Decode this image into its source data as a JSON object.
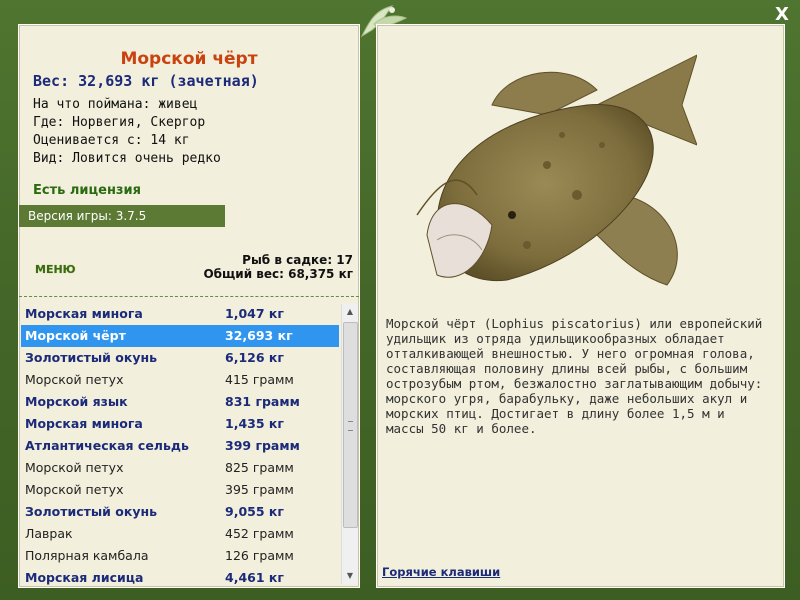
{
  "window": {
    "close_label": "X"
  },
  "fish": {
    "name": "Морской чёрт",
    "weight": "Вес: 32,693 кг (зачетная)",
    "info": [
      "На что поймана: живец",
      "Где: Норвегия, Скергор",
      "Оценивается с: 14 кг",
      "Вид: Ловится очень редко"
    ],
    "description": "Морской чёрт (Lophius piscatorius) или европейский удильщик из отряда удильщикообразных обладает отталкивающей внешностью. У него огромная голова, составляющая половину длины всей рыбы, с большим острозубым ртом, безжалостно заглатывающим добычу: морского угря, барабульку, даже небольших акул и морских птиц. Достигает в длину более 1,5 м и массы 50 кг и более."
  },
  "license": "Есть лицензия",
  "version": "Версия игры: 3.7.5",
  "menu_label": "МЕНЮ",
  "stats": {
    "count": "Рыб в садке: 17",
    "total": "Общий вес: 68,375 кг"
  },
  "catch_list": [
    {
      "name": "Морская минога",
      "weight": "1,047 кг",
      "style": "bold"
    },
    {
      "name": "Морской чёрт",
      "weight": "32,693 кг",
      "style": "sel"
    },
    {
      "name": "Золотистый окунь",
      "weight": "6,126 кг",
      "style": "bold"
    },
    {
      "name": "Морской петух",
      "weight": "415 грамм",
      "style": "plain"
    },
    {
      "name": "Морской язык",
      "weight": "831 грамм",
      "style": "bold"
    },
    {
      "name": "Морская минога",
      "weight": "1,435 кг",
      "style": "bold"
    },
    {
      "name": "Атлантическая сельдь",
      "weight": "399 грамм",
      "style": "bold"
    },
    {
      "name": "Морской петух",
      "weight": "825 грамм",
      "style": "plain"
    },
    {
      "name": "Морской петух",
      "weight": "395 грамм",
      "style": "plain"
    },
    {
      "name": "Золотистый окунь",
      "weight": "9,055 кг",
      "style": "bold"
    },
    {
      "name": "Лаврак",
      "weight": "452 грамм",
      "style": "plain"
    },
    {
      "name": "Полярная камбала",
      "weight": "126 грамм",
      "style": "plain"
    },
    {
      "name": "Морская лисица",
      "weight": "4,461 кг",
      "style": "bold"
    }
  ],
  "hotkeys_label": "Горячие клавиши",
  "colors": {
    "frame": "#4a6a2a",
    "panel": "#f2efdc",
    "selection": "#2f95ee",
    "title": "#c9430f",
    "accent_text": "#1c2a7a"
  }
}
